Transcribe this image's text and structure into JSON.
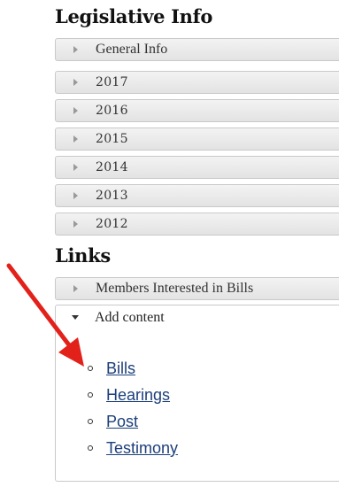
{
  "sections": {
    "legislative_title": "Legislative Info",
    "links_title": "Links"
  },
  "legislative_items": [
    {
      "label": "General Info"
    },
    {
      "label": "2017"
    },
    {
      "label": "2016"
    },
    {
      "label": "2015"
    },
    {
      "label": "2014"
    },
    {
      "label": "2013"
    },
    {
      "label": "2012"
    }
  ],
  "links_items": [
    {
      "label": "Members Interested in Bills"
    }
  ],
  "add_content": {
    "label": "Add content",
    "links": [
      {
        "label": "Bills"
      },
      {
        "label": "Hearings"
      },
      {
        "label": "Post"
      },
      {
        "label": "Testimony"
      }
    ]
  },
  "colors": {
    "annotation_arrow": "#e3211b",
    "link": "#1c3f7a"
  }
}
